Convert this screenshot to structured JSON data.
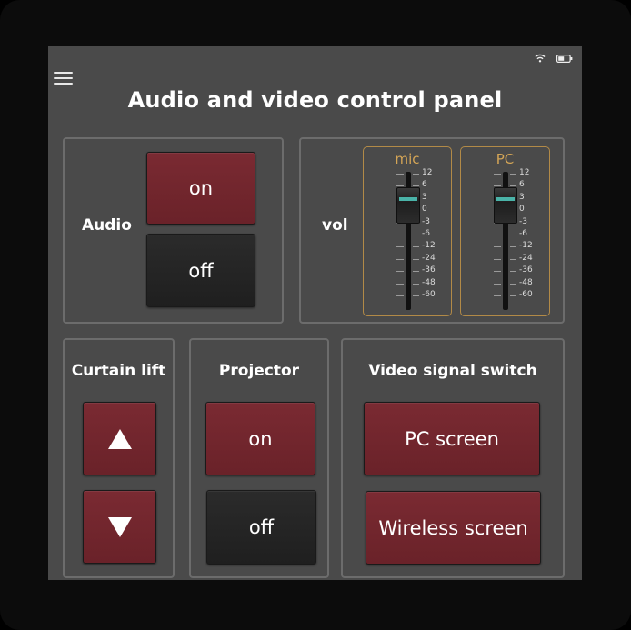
{
  "status": {
    "wifi_icon": "wifi-icon",
    "battery_icon": "battery-icon"
  },
  "menu_icon": "hamburger-menu-icon",
  "title": "Audio and video control panel",
  "audio": {
    "label": "Audio",
    "on_label": "on",
    "off_label": "off"
  },
  "volume": {
    "label": "vol",
    "scale": [
      "12",
      "6",
      "3",
      "0",
      "-3",
      "-6",
      "-12",
      "-24",
      "-36",
      "-48",
      "-60"
    ],
    "channels": [
      {
        "name": "mic",
        "level_db": 3
      },
      {
        "name": "PC",
        "level_db": 3
      }
    ],
    "accent_color": "#d4a556"
  },
  "curtain": {
    "label": "Curtain lift",
    "up_icon": "arrow-up-icon",
    "down_icon": "arrow-down-icon"
  },
  "projector": {
    "label": "Projector",
    "on_label": "on",
    "off_label": "off"
  },
  "video_switch": {
    "label": "Video signal switch",
    "pc_label": "PC screen",
    "wireless_label": "Wireless screen"
  },
  "colors": {
    "button_red": "#7a2a32",
    "button_dark": "#262626",
    "screen_bg": "#4a4a4a",
    "panel_border": "#6c6c6c"
  }
}
